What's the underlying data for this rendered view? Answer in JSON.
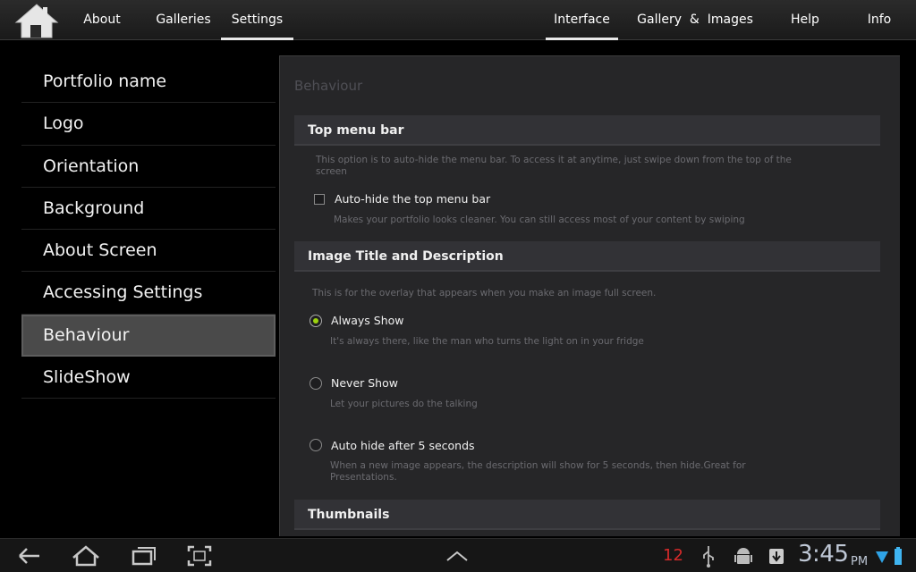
{
  "topbar": {
    "left_tabs": [
      {
        "label": "About"
      },
      {
        "label": "Galleries"
      },
      {
        "label": "Settings",
        "active": true
      }
    ],
    "right_tabs": [
      {
        "label": "Interface",
        "active": true
      },
      {
        "label": "Gallery  &  Images"
      },
      {
        "label": "Help"
      },
      {
        "label": "Info"
      }
    ],
    "home_icon": "home-icon"
  },
  "sidebar": {
    "items": [
      {
        "label": "Portfolio name"
      },
      {
        "label": "Logo"
      },
      {
        "label": "Orientation"
      },
      {
        "label": "Background"
      },
      {
        "label": "About Screen"
      },
      {
        "label": "Accessing Settings"
      },
      {
        "label": "Behaviour",
        "selected": true
      },
      {
        "label": "SlideShow"
      }
    ]
  },
  "panel": {
    "title": "Behaviour",
    "sections": {
      "top_menu": {
        "header": "Top menu bar",
        "description": "This option is to auto-hide the menu bar. To access it at anytime, just swipe down from the top of the screen",
        "option_label": "Auto-hide the top menu bar",
        "option_checked": false,
        "option_desc": "Makes your portfolio looks cleaner. You can still access most of your content by swiping"
      },
      "image_title": {
        "header": "Image Title and Description",
        "description": "This is for the overlay that appears when you make an image full screen.",
        "options": [
          {
            "label": "Always Show",
            "desc": "It's always there, like the man who turns the light on in your fridge",
            "checked": true
          },
          {
            "label": "Never Show",
            "desc": "Let your pictures do the talking",
            "checked": false
          },
          {
            "label": "Auto hide after 5 seconds",
            "desc": "When a new image appears, the description will show for 5 seconds, then hide.Great for Presentations.",
            "checked": false
          }
        ]
      },
      "thumbnails": {
        "header": "Thumbnails"
      }
    }
  },
  "sysbar": {
    "notification_count": "12",
    "time": "3:45",
    "ampm": "PM",
    "icons": [
      "back-icon",
      "home-icon",
      "recent-apps-icon",
      "screenshot-icon",
      "up-chevron-icon",
      "usb-icon",
      "android-debug-icon",
      "download-icon",
      "wifi-icon",
      "battery-icon"
    ],
    "accent": "#9cd20e",
    "alert_color": "#d52a2a"
  }
}
